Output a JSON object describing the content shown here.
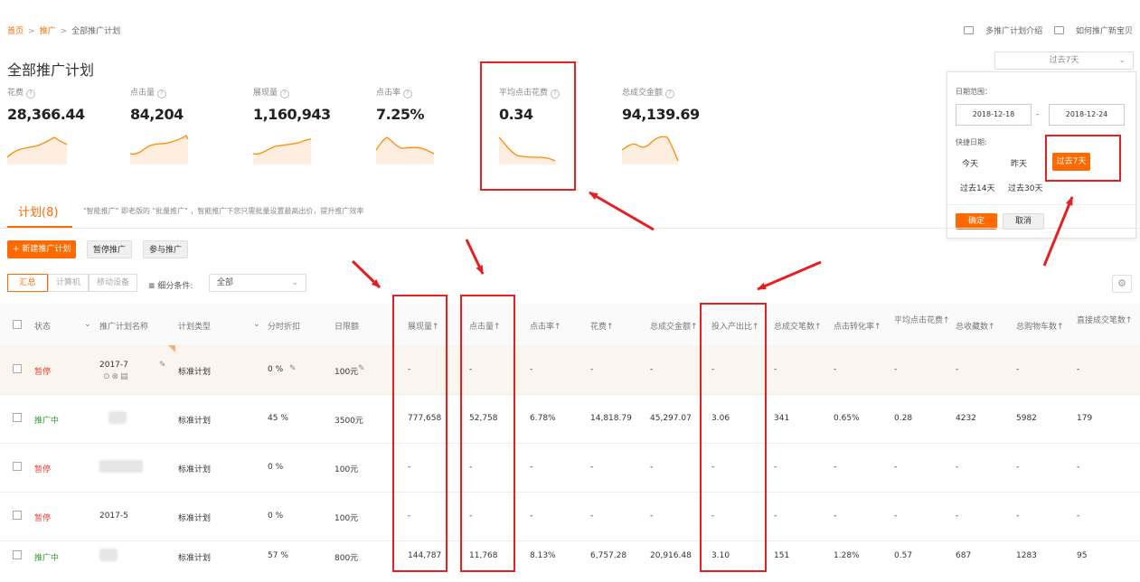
{
  "breadcrumb": {
    "home": "首页",
    "promo": "推广",
    "current": "全部推广计划",
    "sep": ">"
  },
  "header_links": {
    "intro": "多推广计划介绍",
    "how": "如何推广新宝贝"
  },
  "page_title": "全部推广计划",
  "metrics": [
    {
      "label": "花费",
      "value": "28,366.44"
    },
    {
      "label": "点击量",
      "value": "84,204"
    },
    {
      "label": "展现量",
      "value": "1,160,943"
    },
    {
      "label": "点击率",
      "value": "7.25%"
    },
    {
      "label": "平均点击花费",
      "value": "0.34"
    },
    {
      "label": "总成交金额",
      "value": "94,139.69"
    }
  ],
  "help_glyph": "?",
  "date_select": {
    "value": "过去7天"
  },
  "date_panel": {
    "range_label": "日期范围：",
    "start": "2018-12-18",
    "dash": "-",
    "end": "2018-12-24",
    "quick_label": "快捷日期:",
    "quick": [
      "今天",
      "昨天",
      "过去7天",
      "过去14天",
      "过去30天"
    ],
    "confirm": "确定",
    "cancel": "取消"
  },
  "tabs": {
    "plan": "计划(8)",
    "desc": "\"智能推广\" 即老版的 \"批量推广\" ，智能推广下您只需批量设置最高出价，提升推广效率"
  },
  "actions": {
    "new_plan": "+ 新建推广计划",
    "pause": "暂停推广",
    "join": "参与推广"
  },
  "segments": {
    "all": "汇总",
    "pc": "计算机",
    "mobile": "移动设备"
  },
  "filter": {
    "label": "细分条件:",
    "value": "全部"
  },
  "columns": [
    "状态",
    "推广计划名称",
    "计划类型",
    "分时折扣",
    "日限额",
    "展现量↑",
    "点击量↑",
    "点击率↑",
    "花费↑",
    "总成交金额↑",
    "投入产出比↑",
    "总成交笔数↑",
    "点击转化率↑",
    "平均点击花费↑",
    "总收藏数↑",
    "总购物车数↑",
    "直接成交笔数↑"
  ],
  "rows": [
    {
      "status": "暂停",
      "status_type": "pause",
      "name": "2017-7",
      "type": "标准计划",
      "discount": "0 %",
      "limit": "100元",
      "impr": "-",
      "clicks": "-",
      "ctr": "-",
      "cost": "-",
      "gmv": "-",
      "roi": "-",
      "orders": "-",
      "cvr": "-",
      "cpc": "-",
      "fav": "-",
      "cart": "-",
      "direct": "-"
    },
    {
      "status": "推广中",
      "status_type": "run",
      "name": "",
      "type": "标准计划",
      "discount": "45 %",
      "limit": "3500元",
      "impr": "777,658",
      "clicks": "52,758",
      "ctr": "6.78%",
      "cost": "14,818.79",
      "gmv": "45,297.07",
      "roi": "3.06",
      "orders": "341",
      "cvr": "0.65%",
      "cpc": "0.28",
      "fav": "4232",
      "cart": "5982",
      "direct": "179"
    },
    {
      "status": "暂停",
      "status_type": "pause",
      "name": "",
      "type": "标准计划",
      "discount": "0 %",
      "limit": "100元",
      "impr": "-",
      "clicks": "-",
      "ctr": "-",
      "cost": "-",
      "gmv": "-",
      "roi": "-",
      "orders": "-",
      "cvr": "-",
      "cpc": "-",
      "fav": "-",
      "cart": "-",
      "direct": "-"
    },
    {
      "status": "暂停",
      "status_type": "pause",
      "name": "2017-5",
      "type": "标准计划",
      "discount": "0 %",
      "limit": "100元",
      "impr": "-",
      "clicks": "-",
      "ctr": "-",
      "cost": "-",
      "gmv": "-",
      "roi": "-",
      "orders": "-",
      "cvr": "-",
      "cpc": "-",
      "fav": "-",
      "cart": "-",
      "direct": "-"
    },
    {
      "status": "推广中",
      "status_type": "run",
      "name": "",
      "type": "标准计划",
      "discount": "57 %",
      "limit": "800元",
      "impr": "144,787",
      "clicks": "11,768",
      "ctr": "8.13%",
      "cost": "6,757.28",
      "gmv": "20,916.48",
      "roi": "3.10",
      "orders": "151",
      "cvr": "1.28%",
      "cpc": "0.57",
      "fav": "687",
      "cart": "1283",
      "direct": "95"
    }
  ],
  "colors": {
    "accent": "#ff6a00",
    "annotation": "#e62020",
    "pause": "#e8412c",
    "running": "#2f9a2f"
  }
}
